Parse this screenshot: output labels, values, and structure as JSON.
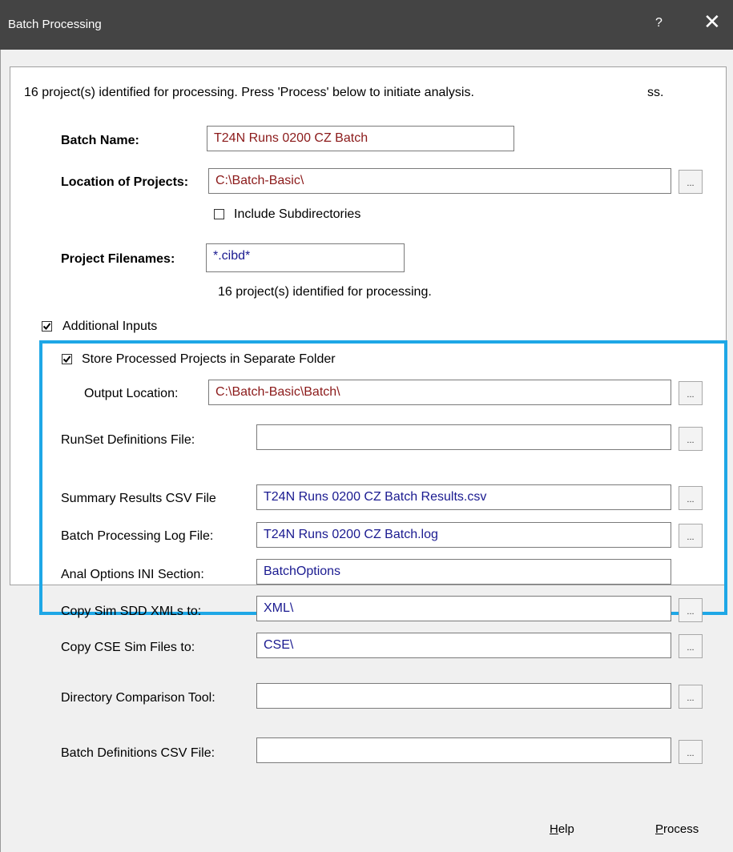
{
  "window": {
    "title": "Batch Processing",
    "help_glyph": "?",
    "close_glyph": "✕"
  },
  "status_top": "16 project(s) identified for processing.  Press 'Process' below to initiate analysis.",
  "status_top_fragment": "ss.",
  "batch_name": {
    "label": "Batch Name:",
    "value": "T24N Runs 0200 CZ Batch"
  },
  "location": {
    "label": "Location of Projects:",
    "value": "C:\\Batch-Basic\\",
    "browse": "..."
  },
  "include_subdirs": {
    "label": "Include Subdirectories",
    "checked": false
  },
  "filenames": {
    "label": "Project Filenames:",
    "value": "*.cibd*"
  },
  "status_mid": "16 project(s) identified for processing.",
  "additional_inputs": {
    "label": "Additional Inputs",
    "checked": true
  },
  "store_separate": {
    "label": "Store Processed Projects in Separate Folder",
    "checked": true
  },
  "output_location": {
    "label": "Output Location:",
    "value": "C:\\Batch-Basic\\Batch\\",
    "browse": "..."
  },
  "runset": {
    "label": "RunSet Definitions File:",
    "value": "",
    "browse": "..."
  },
  "summary_csv": {
    "label": "Summary Results CSV File",
    "value": "T24N Runs 0200 CZ Batch Results.csv",
    "browse": "..."
  },
  "log_file": {
    "label": "Batch Processing Log File:",
    "value": "T24N Runs 0200 CZ Batch.log",
    "browse": "..."
  },
  "ini_section": {
    "label": "Anal Options INI Section:",
    "value": "BatchOptions"
  },
  "sdd_xml": {
    "label": "Copy Sim SDD XMLs to:",
    "value": "XML\\",
    "browse": "..."
  },
  "cse_files": {
    "label": "Copy CSE Sim Files to:",
    "value": "CSE\\",
    "browse": "..."
  },
  "dir_compare": {
    "label": "Directory Comparison Tool:",
    "value": "",
    "browse": "..."
  },
  "batch_defs": {
    "label": "Batch Definitions CSV File:",
    "value": "",
    "browse": "..."
  },
  "buttons": {
    "help_key": "H",
    "help_rest": "elp",
    "process_key": "P",
    "process_rest": "rocess"
  },
  "colors": {
    "highlight": "#1ea7e6",
    "titlebar": "#444444",
    "red_text": "#8b1a1a",
    "blue_text": "#1a1a90"
  }
}
